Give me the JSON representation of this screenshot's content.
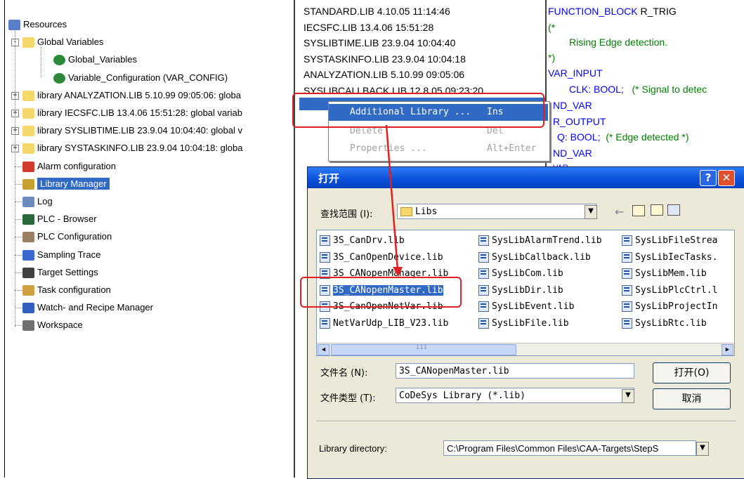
{
  "tree": {
    "items": [
      {
        "label": "Resources",
        "icon": "resources-icon"
      },
      {
        "label": "Global Variables",
        "icon": "folder-open-icon"
      },
      {
        "label": "Global_Variables",
        "icon": "globe-icon"
      },
      {
        "label": "Variable_Configuration (VAR_CONFIG)",
        "icon": "globe-icon"
      },
      {
        "label": "library ANALYZATION.LIB 5.10.99 09:05:06: globa",
        "icon": "folder-icon"
      },
      {
        "label": "library IECSFC.LIB 13.4.06 15:51:28: global variab",
        "icon": "folder-icon"
      },
      {
        "label": "library SYSLIBTIME.LIB 23.9.04 10:04:40: global v",
        "icon": "folder-icon"
      },
      {
        "label": "library SYSTASKINFO.LIB 23.9.04 10:04:18: globa",
        "icon": "folder-icon"
      },
      {
        "label": "Alarm configuration",
        "icon": "alarm-icon"
      },
      {
        "label": "Library Manager",
        "icon": "library-manager-icon"
      },
      {
        "label": "Log",
        "icon": "log-icon"
      },
      {
        "label": "PLC - Browser",
        "icon": "plc-browser-icon"
      },
      {
        "label": "PLC Configuration",
        "icon": "plc-configuration-icon"
      },
      {
        "label": "Sampling Trace",
        "icon": "sampling-trace-icon"
      },
      {
        "label": "Target Settings",
        "icon": "target-settings-icon"
      },
      {
        "label": "Task configuration",
        "icon": "task-configuration-icon"
      },
      {
        "label": "Watch- and Recipe Manager",
        "icon": "watch-icon"
      },
      {
        "label": "Workspace",
        "icon": "workspace-icon"
      }
    ],
    "expanders": [
      "-",
      "-",
      "+",
      "+",
      "+",
      "+"
    ]
  },
  "libraries": [
    "STANDARD.LIB 4.10.05 11:14:46",
    "IECSFC.LIB 13.4.06 15:51:28",
    "SYSLIBTIME.LIB 23.9.04 10:04:40",
    "SYSTASKINFO.LIB 23.9.04 10:04:18",
    "ANALYZATION.LIB 5.10.99 09:05:06",
    "SYSLIBCALLBACK.LIB 12.8.05 09:23:20"
  ],
  "code": {
    "l1_kw": "FUNCTION_BLOCK",
    "l1_name": " R_TRIG",
    "l2": "(*",
    "l3": "Rising Edge detection.",
    "l4": "*)",
    "l5": "VAR_INPUT",
    "l6_name": "CLK: BOOL;",
    "l6_cm": "(* Signal to detec",
    "l7": "ND_VAR",
    "l8": "R_OUTPUT",
    "l9_name": "Q: BOOL;",
    "l9_cm": "(* Edge detected *)",
    "l10": "ND_VAR",
    "l11": "VAR"
  },
  "context_menu": {
    "items": [
      {
        "label": "Additional Library ...",
        "shortcut": "Ins"
      },
      {
        "label": "Delete",
        "shortcut": "Del"
      },
      {
        "label": "Properties ...",
        "shortcut": "Alt+Enter"
      }
    ]
  },
  "dialog": {
    "title": "打开",
    "help": "?",
    "close": "✕",
    "look_in_label": "查找范围 (I):",
    "look_in_value": "Libs",
    "files": [
      "3S_CanDrv.lib",
      "3S_CanOpenDevice.lib",
      "3S_CANopenManager.lib",
      "3S_CANopenMaster.lib",
      "3S_CanOpenNetVar.lib",
      "NetVarUdp_LIB_V23.lib",
      "SysLibAlarmTrend.lib",
      "SysLibCallback.lib",
      "SysLibCom.lib",
      "SysLibDir.lib",
      "SysLibEvent.lib",
      "SysLibFile.lib",
      "SysLibFileStrea",
      "SysLibIecTasks.",
      "SysLibMem.lib",
      "SysLibPlcCtrl.l",
      "SysLibProjectIn",
      "SysLibRtc.lib"
    ],
    "filename_label": "文件名 (N):",
    "filename_value": "3S_CANopenMaster.lib",
    "filetype_label": "文件类型 (T):",
    "filetype_value": "CoDeSys Library (*.lib)",
    "open_button": "打开(O)",
    "cancel_button": "取消",
    "libdir_label": "Library directory:",
    "libdir_value": "C:\\Program Files\\Common Files\\CAA-Targets\\StepS",
    "scroll_marks": "III"
  },
  "colors": {
    "selection": "#316ac5",
    "annotation": "#e02020",
    "title_bar": "#0a4fd9"
  }
}
